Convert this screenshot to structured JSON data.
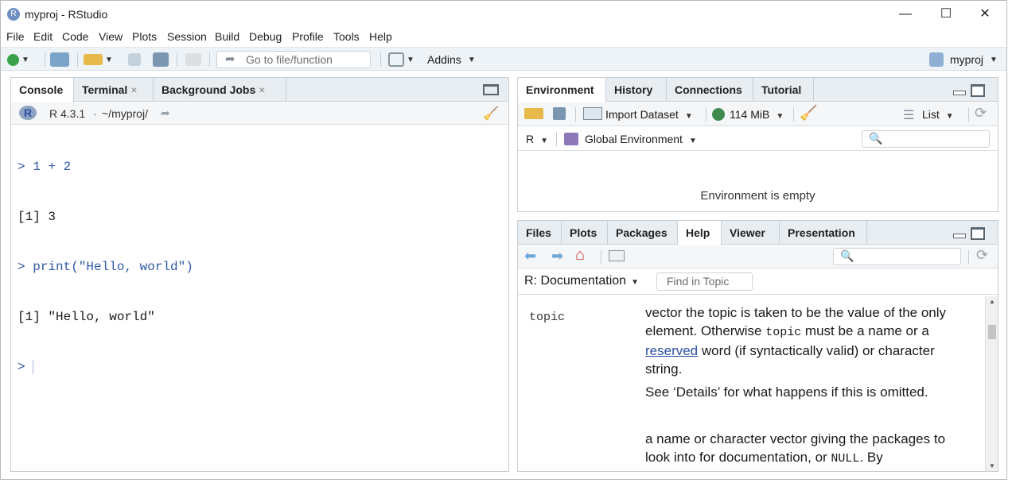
{
  "window": {
    "title": "myproj - RStudio",
    "app_icon": "R"
  },
  "menu": [
    "File",
    "Edit",
    "Code",
    "View",
    "Plots",
    "Session",
    "Build",
    "Debug",
    "Profile",
    "Tools",
    "Help"
  ],
  "toolbar": {
    "goto_placeholder": "Go to file/function",
    "addins_label": "Addins",
    "project_label": "myproj"
  },
  "left_panel": {
    "tabs": [
      {
        "label": "Console"
      },
      {
        "label": "Terminal",
        "closable": "×"
      },
      {
        "label": "Background Jobs",
        "closable": "×"
      }
    ],
    "r_version": "R 4.3.1",
    "separator": "·",
    "path": "~/myproj/",
    "console_lines": [
      {
        "prompt": ">",
        "text": " 1 + 2"
      },
      {
        "prompt": "",
        "text": "[1] 3"
      },
      {
        "prompt": ">",
        "text": " print(\"Hello, world\")"
      },
      {
        "prompt": "",
        "text": "[1] \"Hello, world\""
      },
      {
        "prompt": ">",
        "text": " "
      }
    ]
  },
  "env_panel": {
    "tabs": [
      "Environment",
      "History",
      "Connections",
      "Tutorial"
    ],
    "import_label": "Import Dataset",
    "memory_label": "114 MiB",
    "list_label": "List",
    "lang_label": "R",
    "scope_label": "Global Environment",
    "empty_message": "Environment is empty"
  },
  "files_panel": {
    "tabs": [
      "Files",
      "Plots",
      "Packages",
      "Help",
      "Viewer",
      "Presentation"
    ],
    "doc_label": "R: Documentation",
    "find_placeholder": "Find in Topic",
    "param_name": "topic",
    "para1_a": "vector the topic is taken to be the value of the only element. Otherwise ",
    "para1_code": "topic",
    "para1_b": " must be a name or a ",
    "para1_link": "reserved",
    "para1_c": " word (if syntactically valid) or character string.",
    "para2": "See ‘Details’ for what happens if this is omitted.",
    "para3_a": "a name or character vector giving the packages to look into for documentation, or ",
    "para3_code": "NULL",
    "para3_b": ". By"
  },
  "colors": {
    "accent": "#2f58a6",
    "toolbar_bg": "#eef3f7",
    "tab_bg": "#e8edf1"
  }
}
